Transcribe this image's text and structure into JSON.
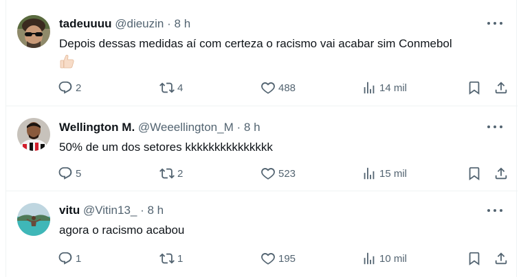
{
  "tweets": [
    {
      "name": "tadeuuuu",
      "handle": "@dieuzin",
      "dot": "·",
      "time": "8 h",
      "text": "Depois dessas medidas aí com certeza o racismo vai acabar sim Conmebol",
      "emoji": "thumbs-up-light-skin",
      "replies": "2",
      "reposts": "4",
      "likes": "488",
      "views": "14 mil"
    },
    {
      "name": "Wellington M.",
      "handle": "@Weeellington_M",
      "dot": "·",
      "time": "8 h",
      "text": "50% de um dos setores kkkkkkkkkkkkkkk",
      "replies": "5",
      "reposts": "2",
      "likes": "523",
      "views": "15 mil"
    },
    {
      "name": "vitu",
      "handle": "@Vitin13_",
      "dot": "·",
      "time": "8 h",
      "text": "agora o racismo acabou",
      "replies": "1",
      "reposts": "1",
      "likes": "195",
      "views": "10 mil"
    }
  ],
  "colors": {
    "text": "#0f1419",
    "secondary": "#536471",
    "divider": "#eff3f4"
  },
  "icons": [
    "reply-icon",
    "repost-icon",
    "like-icon",
    "views-icon",
    "bookmark-icon",
    "share-icon",
    "more-icon"
  ]
}
